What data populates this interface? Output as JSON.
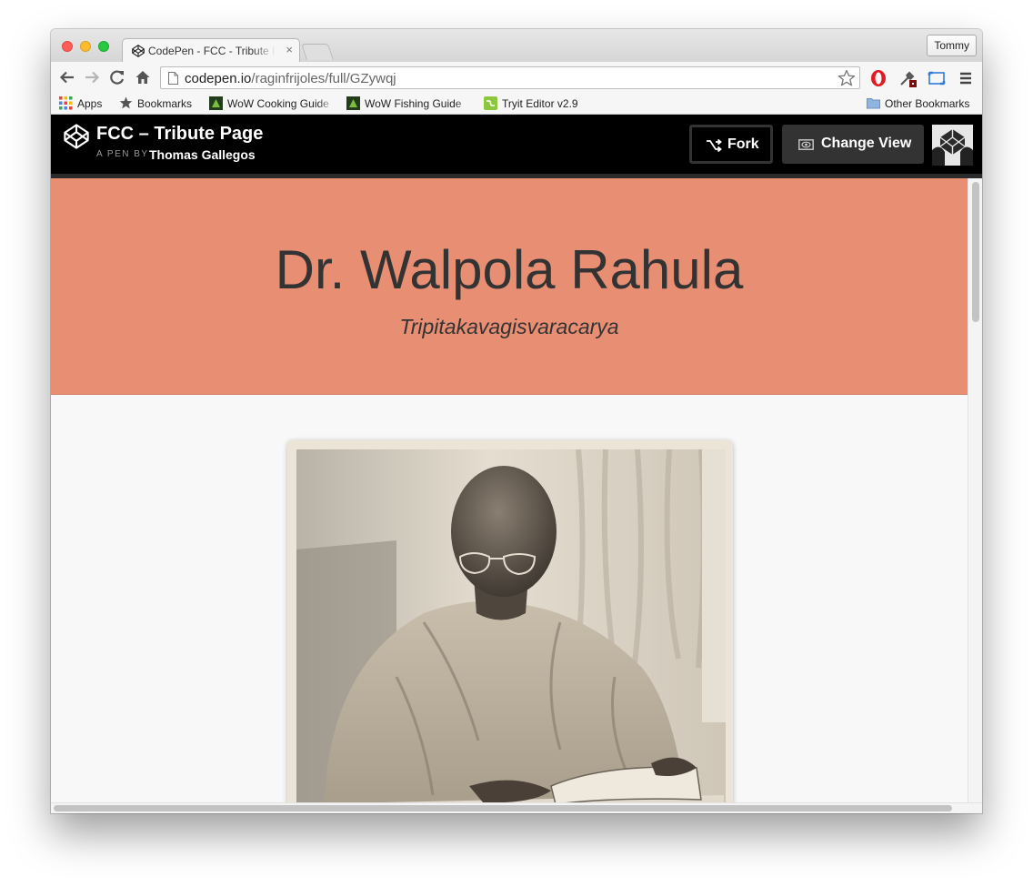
{
  "browser": {
    "tab": {
      "title": "CodePen - FCC - Tribute Page",
      "close_glyph": "×",
      "favicon": "codepen-icon"
    },
    "profile_name": "Tommy",
    "address": {
      "host": "codepen.io",
      "path": "/raginfrijoles/full/GZywqj"
    },
    "nav_icons": [
      "back-icon",
      "forward-icon",
      "reload-icon",
      "home-icon"
    ],
    "extension_icons": [
      "bookmark-star-icon",
      "opera-icon",
      "eyedropper-icon",
      "window-resize-icon",
      "menu-icon"
    ],
    "bookmarks": {
      "apps": "Apps",
      "bookmarks": "Bookmarks",
      "cooking": "WoW Cooking Guide",
      "fishing": "WoW Fishing Guide",
      "tryit": "Tryit Editor v2.9",
      "other": "Other Bookmarks"
    }
  },
  "codepen": {
    "pen_title": "FCC – Tribute Page",
    "by_label": "A PEN BY",
    "author": "Thomas Gallegos",
    "fork_label": "Fork",
    "change_view_label": "Change View"
  },
  "page": {
    "title": "Dr. Walpola Rahula",
    "subtitle": "Tripitakavagisvaracarya"
  },
  "colors": {
    "hero_background": "#e88e73",
    "codepen_header": "#000000",
    "page_background": "#f8f8f8"
  }
}
